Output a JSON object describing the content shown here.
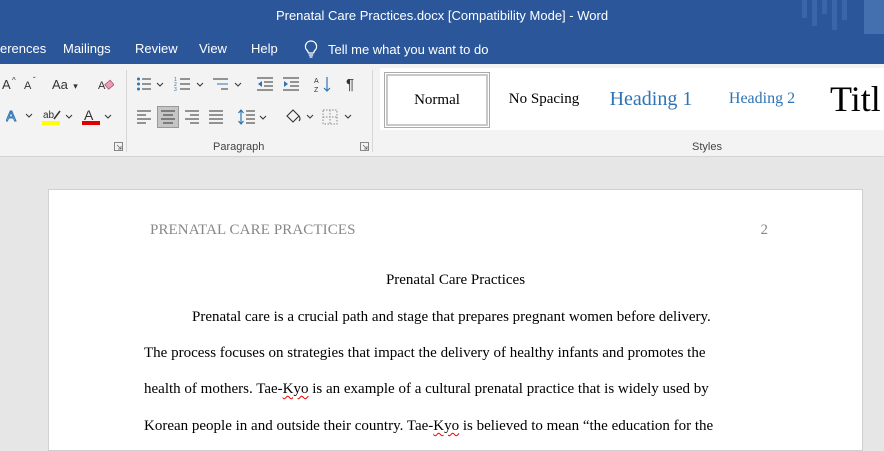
{
  "window": {
    "title": "Prenatal Care Practices.docx [Compatibility Mode]  -  Word"
  },
  "menu": {
    "items": [
      "erences",
      "Mailings",
      "Review",
      "View",
      "Help"
    ],
    "tell_me": "Tell me what you want to do"
  },
  "ribbon": {
    "paragraph_label": "Paragraph",
    "styles_label": "Styles",
    "font_case_label": "Aa",
    "styles": [
      "Normal",
      "No Spacing",
      "Heading 1",
      "Heading 2",
      "Titl"
    ],
    "colors": {
      "highlight": "#ffff00",
      "font_color": "#e00000",
      "text_effects": "#2e74b5"
    }
  },
  "document": {
    "header_left": "PRENATAL CARE PRACTICES",
    "page_number": "2",
    "title": "Prenatal Care Practices",
    "line1": "Prenatal care is a crucial path and stage that prepares pregnant women before delivery.",
    "line2": "The process focuses on strategies that impact the delivery of healthy infants and promotes the",
    "line3_a": "health of mothers. Tae-",
    "line3_b": "Kyo",
    "line3_c": " is an example of a cultural prenatal practice that is widely used by",
    "line4_a": "Korean people in and outside their country. Tae-",
    "line4_b": "Kyo",
    "line4_c": " is believed to mean “the education for the"
  },
  "theme": {
    "accent": "#2b579a",
    "heading_blue": "#2e74b5",
    "spell_error": "#e00000"
  }
}
